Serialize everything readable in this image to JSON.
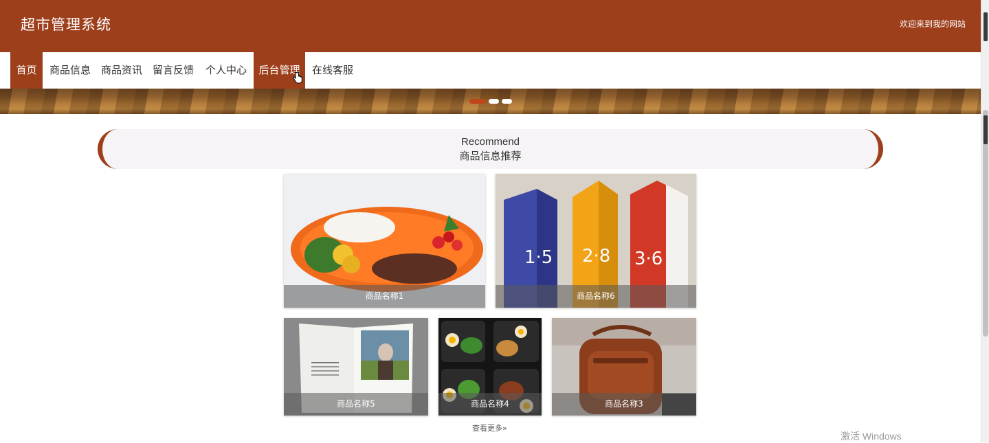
{
  "header": {
    "title": "超市管理系统",
    "welcome": "欢迎来到我的网站"
  },
  "nav": {
    "items": [
      {
        "label": "首页",
        "state": "active"
      },
      {
        "label": "商品信息",
        "state": "normal"
      },
      {
        "label": "商品资讯",
        "state": "normal"
      },
      {
        "label": "留言反馈",
        "state": "normal"
      },
      {
        "label": "个人中心",
        "state": "normal"
      },
      {
        "label": "后台管理",
        "state": "hover"
      },
      {
        "label": "在线客服",
        "state": "normal"
      }
    ]
  },
  "carousel": {
    "slide_count": 3,
    "active_index": 0
  },
  "recommend": {
    "title_en": "Recommend",
    "title_zh": "商品信息推荐",
    "products": [
      {
        "name": "商品名称1",
        "image": "bento-box-photo"
      },
      {
        "name": "商品名称6",
        "image": "milk-cartons-photo"
      },
      {
        "name": "商品名称5",
        "image": "magazine-photo"
      },
      {
        "name": "商品名称4",
        "image": "meal-prep-boxes-photo"
      },
      {
        "name": "商品名称3",
        "image": "leather-bag-photo"
      }
    ],
    "more_label": "查看更多",
    "more_icon": "double-chevron-right-icon"
  },
  "os_watermark": "激活 Windows",
  "colors": {
    "brand": "#9e3f1c",
    "active_dot": "#c0451b",
    "caption_bg": "rgba(90,90,90,0.55)"
  }
}
